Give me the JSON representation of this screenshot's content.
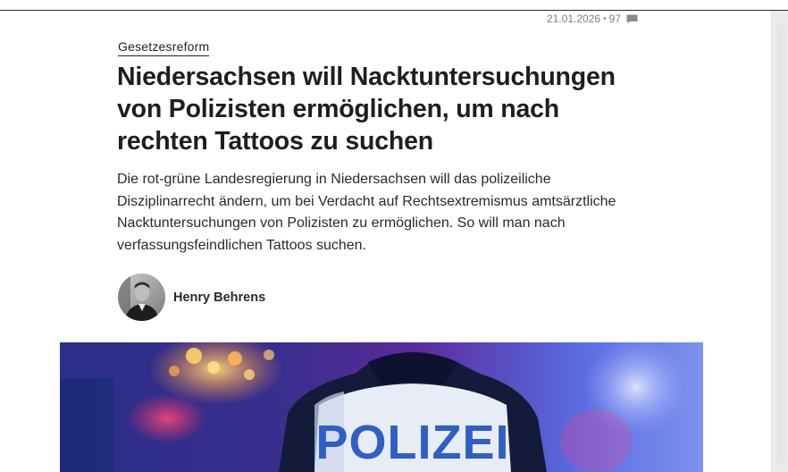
{
  "meta": {
    "date": "21.01.2026",
    "separator": "•",
    "comment_count": "97"
  },
  "article": {
    "kicker": "Gesetzesreform",
    "headline_lines": [
      "Niedersachsen will Nacktuntersuchungen",
      "von Polizisten ermöglichen, um nach",
      "rechten Tattoos zu suchen"
    ],
    "lede_lines": [
      "Die rot-grüne Landesregierung in Niedersachsen will das polizeiliche",
      "Disziplinarrecht ändern, um bei Verdacht auf Rechtsextremismus amtsärztliche",
      "Nacktuntersuchungen von Polizisten zu ermöglichen. So will man nach",
      "verfassungsfeindlichen Tattoos suchen."
    ]
  },
  "author": {
    "name": "Henry Behrens"
  },
  "hero_image": {
    "vest_text": "POLIZEI"
  },
  "icons": {
    "comment": "speech-bubble-icon"
  },
  "colors": {
    "text": "#1e1e1e",
    "meta": "#7f7f7f",
    "vest_blue": "#2f5fc4"
  }
}
